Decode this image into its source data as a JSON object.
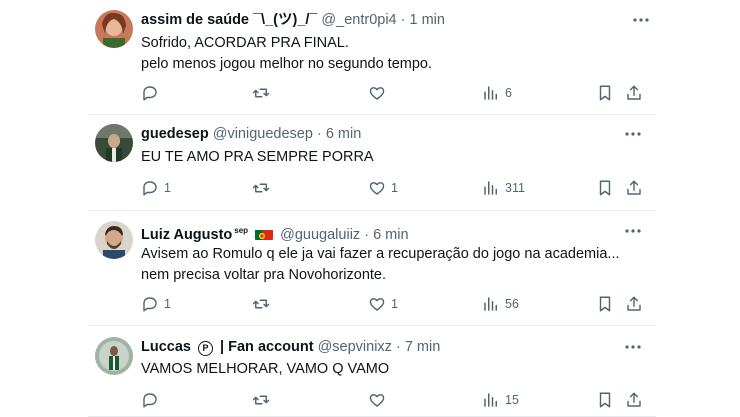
{
  "posts": [
    {
      "name": "assim de saúde ¯\\_(ツ)_/¯",
      "handle": "@_entr0pi4",
      "time": "1 min",
      "lines": [
        "Sofrido, ACORDAR PRA FINAL.",
        "pelo menos jogou melhor no segundo tempo."
      ],
      "replies": "",
      "reposts": "",
      "likes": "",
      "views": "6"
    },
    {
      "name": "guedesep",
      "handle": "@viniguedesep",
      "time": "6 min",
      "lines": [
        "EU TE AMO PRA SEMPRE PORRA"
      ],
      "replies": "1",
      "reposts": "",
      "likes": "1",
      "views": "311"
    },
    {
      "name": "Luiz Augusto",
      "badge": "sep",
      "handle": "@guugaluiiz",
      "time": "6 min",
      "lines": [
        "Avisem ao Romulo q ele ja vai fazer a recuperação do jogo na academia...",
        "nem precisa voltar pra Novohorizonte."
      ],
      "replies": "1",
      "reposts": "",
      "likes": "1",
      "views": "56"
    },
    {
      "name": "Luccas",
      "badge_char": "P",
      "name_suffix": "| Fan account",
      "handle": "@sepvinixz",
      "time": "7 min",
      "lines": [
        "VAMOS MELHORAR, VAMO Q VAMO"
      ],
      "replies": "",
      "reposts": "",
      "likes": "",
      "views": "15"
    }
  ],
  "separator": "·",
  "icons": [
    "more-icon",
    "reply-icon",
    "repost-icon",
    "like-icon",
    "views-icon",
    "bookmark-icon",
    "share-icon"
  ],
  "colors": {
    "text": "#0f1419",
    "secondary": "#536471",
    "divider": "#e7e9ea",
    "flag_green": "#046a38",
    "flag_red": "#da291c"
  }
}
